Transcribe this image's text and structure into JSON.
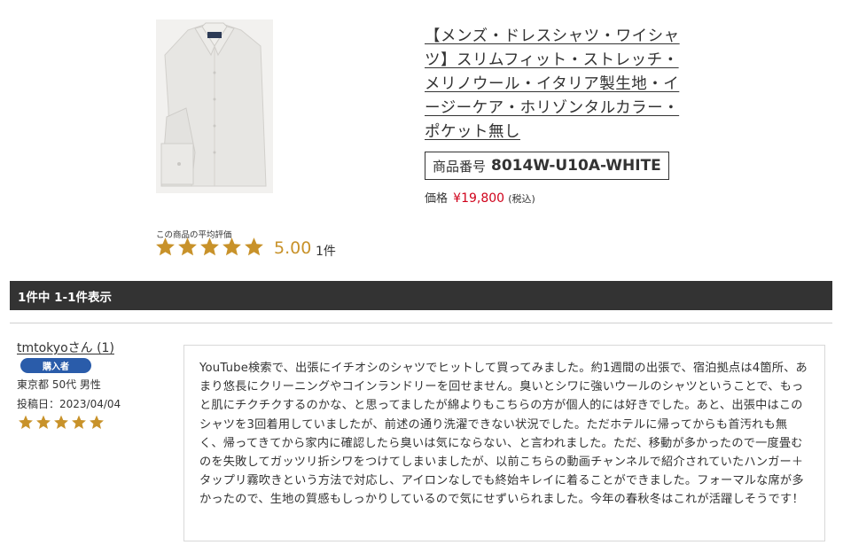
{
  "product": {
    "title": "【メンズ・ドレスシャツ・ワイシャツ】スリムフィット・ストレッチ・メリノウール・イタリア製生地・イージーケア・ホリゾンタルカラー・ポケット無し",
    "code_label": "商品番号",
    "code": "8014W-U10A-WHITE",
    "price_label": "価格",
    "price": "¥19,800",
    "price_tax": "(税込)"
  },
  "rating_summary": {
    "label": "この商品の平均評価",
    "stars": 5,
    "score": "5.00",
    "count": "1件"
  },
  "results": {
    "text": "1件中 1-1件表示"
  },
  "review": {
    "reviewer": "tmtokyoさん (1)",
    "badge": "購入者",
    "info": "東京都 50代 男性",
    "date": "投稿日：2023/04/04",
    "stars": 5,
    "text": "YouTube検索で、出張にイチオシのシャツでヒットして買ってみました。約1週間の出張で、宿泊拠点は4箇所、あまり悠長にクリーニングやコインランドリーを回せません。臭いとシワに強いウールのシャツということで、もっと肌にチクチクするのかな、と思ってましたが綿よりもこちらの方が個人的には好きでした。あと、出張中はこのシャツを3回着用していましたが、前述の通り洗濯できない状況でした。ただホテルに帰ってからも首汚れも無く、帰ってきてから家内に確認したら臭いは気にならない、と言われました。ただ、移動が多かったので一度畳むのを失敗してガッツリ折シワをつけてしまいましたが、以前こちらの動画チャンネルで紹介されていたハンガー＋タップリ霧吹きという方法で対応し、アイロンなしでも終始キレイに着ることができました。フォーマルな席が多かったので、生地の質感もしっかりしているので気にせずいられました。今年の春秋冬はこれが活躍しそうです！"
  },
  "colors": {
    "star": "#c8922a",
    "price": "#d0021b",
    "bar": "#333333",
    "badge": "#2a5caa"
  },
  "icons": {
    "product": "white-dress-shirt-image",
    "star": "star-icon"
  }
}
